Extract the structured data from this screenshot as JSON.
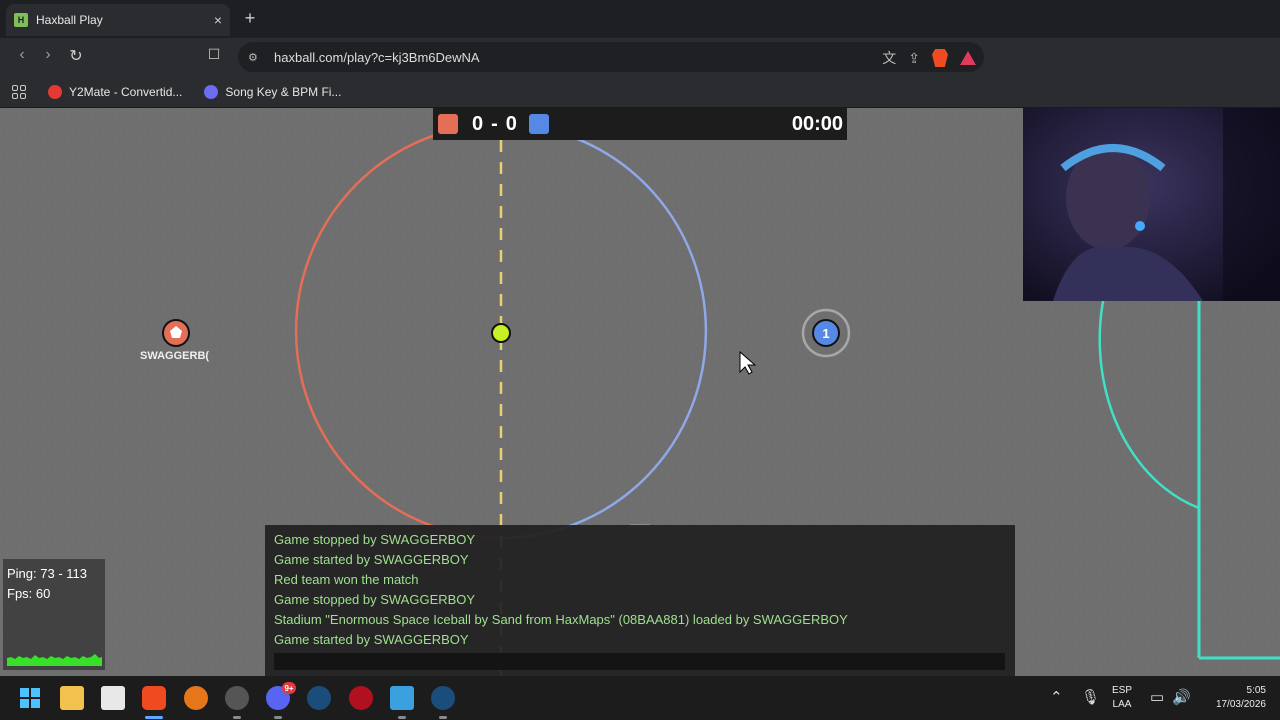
{
  "browser": {
    "tab_title": "Haxball Play",
    "tab_close": "×",
    "new_tab": "+",
    "url": "haxball.com/play?c=kj3Bm6DewNA",
    "brave_shield_count": "2",
    "bookmarks": [
      {
        "label": "Y2Mate - Convertid...",
        "icon_color": "#e53935"
      },
      {
        "label": "Song Key & BPM Fi...",
        "icon_color": "#6c6cf0"
      }
    ]
  },
  "game": {
    "score_red": "0",
    "score_sep": "-",
    "score_blue": "0",
    "timer": "00:00",
    "colors": {
      "red": "#e56e56",
      "blue": "#5689e5",
      "ball": "#c8f025",
      "goal": "#40e0c8"
    },
    "players": [
      {
        "team": "red",
        "name": "SWAGGERB(",
        "avatar": ""
      },
      {
        "team": "blue",
        "name": "",
        "avatar": "1"
      }
    ],
    "chat": [
      "Game stopped by SWAGGERBOY",
      "Game started by SWAGGERBOY",
      "Red team won the match",
      "Game stopped by SWAGGERBOY",
      "Stadium \"Enormous Space Iceball by Sand from HaxMaps\" (08BAA881) loaded by SWAGGERBOY",
      "Game started by SWAGGERBOY"
    ],
    "ping": "Ping: 73 - 113",
    "fps": "Fps: 60"
  },
  "taskbar": {
    "language": "ESP",
    "keyboard": "LAA",
    "time": "5:05",
    "date": "17/03/2026",
    "discord_badge": "9+"
  }
}
